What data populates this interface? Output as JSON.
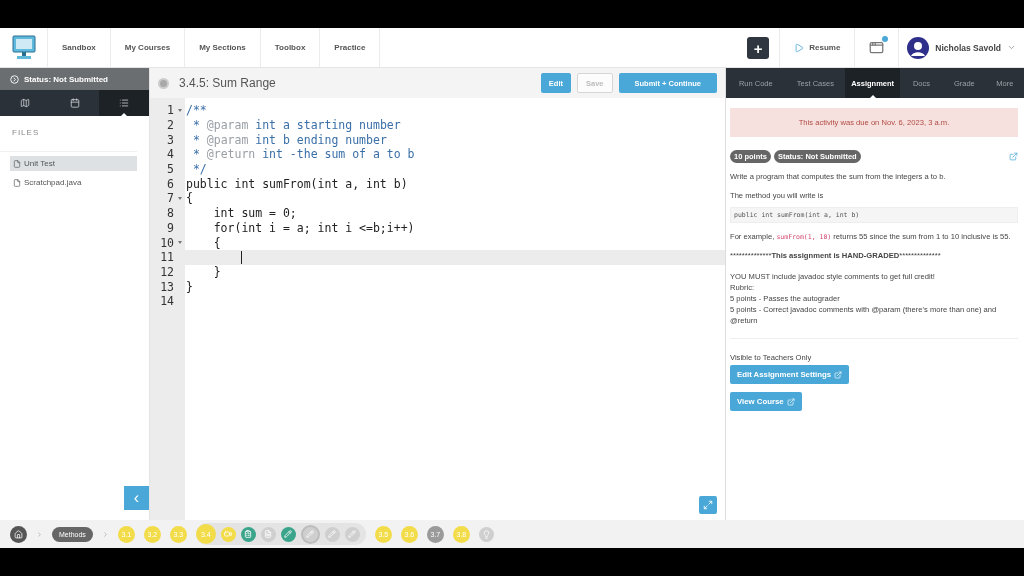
{
  "header": {
    "nav": [
      "Sandbox",
      "My Courses",
      "My Sections",
      "Toolbox",
      "Practice"
    ],
    "add_label": "+",
    "resume": "Resume",
    "notification": true,
    "user": "Nicholas Savold"
  },
  "sidebar": {
    "status": "Status: Not Submitted",
    "tabs": [
      {
        "kind": "map",
        "selected": false
      },
      {
        "kind": "calendar",
        "selected": false
      },
      {
        "kind": "list",
        "selected": true
      }
    ],
    "files_heading": "FILES",
    "files": [
      {
        "name": "Unit Test",
        "selected": true
      },
      {
        "name": "Scratchpad.java",
        "selected": false
      }
    ],
    "collapse": "‹"
  },
  "editor": {
    "title": "3.4.5: Sum Range",
    "buttons": [
      {
        "label": "Edit",
        "kind": "primary",
        "disabled": false
      },
      {
        "label": "Save",
        "kind": "plain",
        "disabled": true
      },
      {
        "label": "Submit + Continue",
        "kind": "primary",
        "disabled": false
      }
    ],
    "lines": [
      {
        "number": "1",
        "fold": true,
        "current": false,
        "segments": [
          {
            "text": "/**",
            "kind": "comment"
          }
        ]
      },
      {
        "number": "2",
        "fold": false,
        "current": false,
        "segments": [
          {
            "text": " * ",
            "kind": "comment"
          },
          {
            "text": "@param",
            "kind": "tag"
          },
          {
            "text": " int a starting number",
            "kind": "comment"
          }
        ]
      },
      {
        "number": "3",
        "fold": false,
        "current": false,
        "segments": [
          {
            "text": " * ",
            "kind": "comment"
          },
          {
            "text": "@param",
            "kind": "tag"
          },
          {
            "text": " int b ending number",
            "kind": "comment"
          }
        ]
      },
      {
        "number": "4",
        "fold": false,
        "current": false,
        "segments": [
          {
            "text": " * ",
            "kind": "comment"
          },
          {
            "text": "@return",
            "kind": "tag"
          },
          {
            "text": " int -the sum of a to b",
            "kind": "comment"
          }
        ]
      },
      {
        "number": "5",
        "fold": false,
        "current": false,
        "segments": [
          {
            "text": " */",
            "kind": "comment"
          }
        ]
      },
      {
        "number": "6",
        "fold": false,
        "current": false,
        "segments": [
          {
            "text": "public int sumFrom(int a, int b)",
            "kind": "code"
          }
        ]
      },
      {
        "number": "7",
        "fold": true,
        "current": false,
        "segments": [
          {
            "text": "{",
            "kind": "code"
          }
        ]
      },
      {
        "number": "8",
        "fold": false,
        "current": false,
        "segments": [
          {
            "text": "    int sum = 0;",
            "kind": "code"
          }
        ]
      },
      {
        "number": "9",
        "fold": false,
        "current": false,
        "segments": [
          {
            "text": "    for(int i = a; int i <=b;i++)",
            "kind": "code"
          }
        ]
      },
      {
        "number": "10",
        "fold": true,
        "current": false,
        "segments": [
          {
            "text": "    {",
            "kind": "code"
          }
        ]
      },
      {
        "number": "11",
        "fold": false,
        "current": true
      },
      {
        "number": "12",
        "fold": false,
        "current": false,
        "segments": [
          {
            "text": "    }",
            "kind": "code"
          }
        ]
      },
      {
        "number": "13",
        "fold": false,
        "current": false,
        "segments": [
          {
            "text": "}",
            "kind": "code"
          }
        ]
      },
      {
        "number": "14",
        "fold": false,
        "current": false
      }
    ]
  },
  "panel": {
    "tabs": [
      {
        "label": "Run Code",
        "selected": false
      },
      {
        "label": "Test Cases",
        "selected": false
      },
      {
        "label": "Assignment",
        "selected": true
      },
      {
        "label": "Docs",
        "selected": false
      },
      {
        "label": "Grade",
        "selected": false
      },
      {
        "label": "More",
        "selected": false
      }
    ],
    "due_notice": "This activity was due on Nov. 6, 2023, 3 a.m.",
    "badges": [
      "10 points",
      "Status: Not Submitted"
    ],
    "intro": "Write a program that computes the sum from the integers a to b.",
    "method_intro": "The method you will write is",
    "method_signature": "public int sumFrom(int a, int b)",
    "example": {
      "before": "For example, ",
      "code": "sumFrom(1, 10)",
      "after": " returns 55 since the sum from 1 to 10 inclusive is 55."
    },
    "hand_graded": {
      "before": "**************",
      "bold": "This assignment is HAND-GRADED",
      "after": "**************"
    },
    "rubric": [
      "YOU MUST include javadoc style comments to get full credit!",
      "Rubric:",
      "5 points - Passes the autograder",
      "5 points - Correct javadoc comments with @param (there's more than one) and @return"
    ],
    "teacher_note": "Visible to Teachers Only",
    "teacher_buttons": [
      "Edit Assignment Settings",
      "View Course"
    ]
  },
  "progress": {
    "module": "Methods",
    "lessons": [
      {
        "label": "3.1",
        "color": "#f3dc4a",
        "selected": false
      },
      {
        "label": "3.2",
        "color": "#f3dc4a",
        "selected": false
      },
      {
        "label": "3.3",
        "color": "#f3dc4a",
        "selected": false
      },
      {
        "label": "3.4",
        "color": "#f3dc4a",
        "selected": true,
        "activities": [
          {
            "kind": "video",
            "color": "#f3dc4a",
            "selected": false
          },
          {
            "kind": "quiz",
            "color": "#3aa58a",
            "selected": false
          },
          {
            "kind": "document",
            "color": "#cfcfcf",
            "selected": false
          },
          {
            "kind": "exercise",
            "color": "#3aa58a",
            "selected": false
          },
          {
            "kind": "exercise",
            "color": "#cfcfcf",
            "selected": true
          },
          {
            "kind": "exercise",
            "color": "#cfcfcf",
            "selected": false
          },
          {
            "kind": "exercise",
            "color": "#cfcfcf",
            "selected": false
          }
        ]
      },
      {
        "label": "3.5",
        "color": "#f3dc4a",
        "selected": false
      },
      {
        "label": "3.6",
        "color": "#f3dc4a",
        "selected": false
      },
      {
        "label": "3.7",
        "color": "#9a9a9a",
        "selected": false
      },
      {
        "label": "3.8",
        "color": "#f3dc4a",
        "selected": false
      }
    ]
  }
}
